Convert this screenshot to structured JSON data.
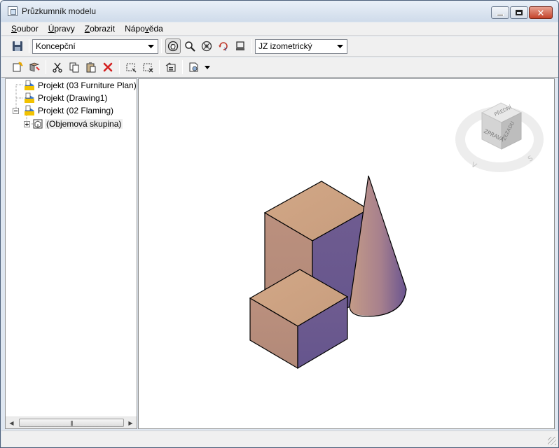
{
  "window": {
    "title": "Průzkumník modelu"
  },
  "menu": [
    {
      "label": "Soubor",
      "accel": "S",
      "rest": "oubor"
    },
    {
      "label": "Úpravy",
      "accel": "Ú",
      "rest": "pravy"
    },
    {
      "label": "Zobrazit",
      "accel": "Z",
      "rest": "obrazit"
    },
    {
      "label": "Nápověda",
      "pre": "Nápo",
      "accel": "v",
      "rest": "ěda"
    }
  ],
  "toolbar": {
    "visual_style": "Koncepční",
    "view_preset": "JZ izometrický"
  },
  "tree": [
    {
      "label": "Projekt (03 Furniture Plan)",
      "level": 0
    },
    {
      "label": "Projekt (Drawing1)",
      "level": 0
    },
    {
      "label": "Projekt (02 Flaming)",
      "level": 0,
      "expanded": true
    },
    {
      "label": "(Objemová skupina)",
      "level": 1,
      "selected": true
    }
  ],
  "viewcube": {
    "face_top": "PŘEDNÍ",
    "face_left": "ZPRAVA",
    "face_right": "ZEZADU",
    "compass_v": "V",
    "compass_s": "S"
  },
  "colors": {
    "face_light": "#c9a07e",
    "face_dark": "#6e5a8f",
    "face_mid": "#b88d7a"
  }
}
